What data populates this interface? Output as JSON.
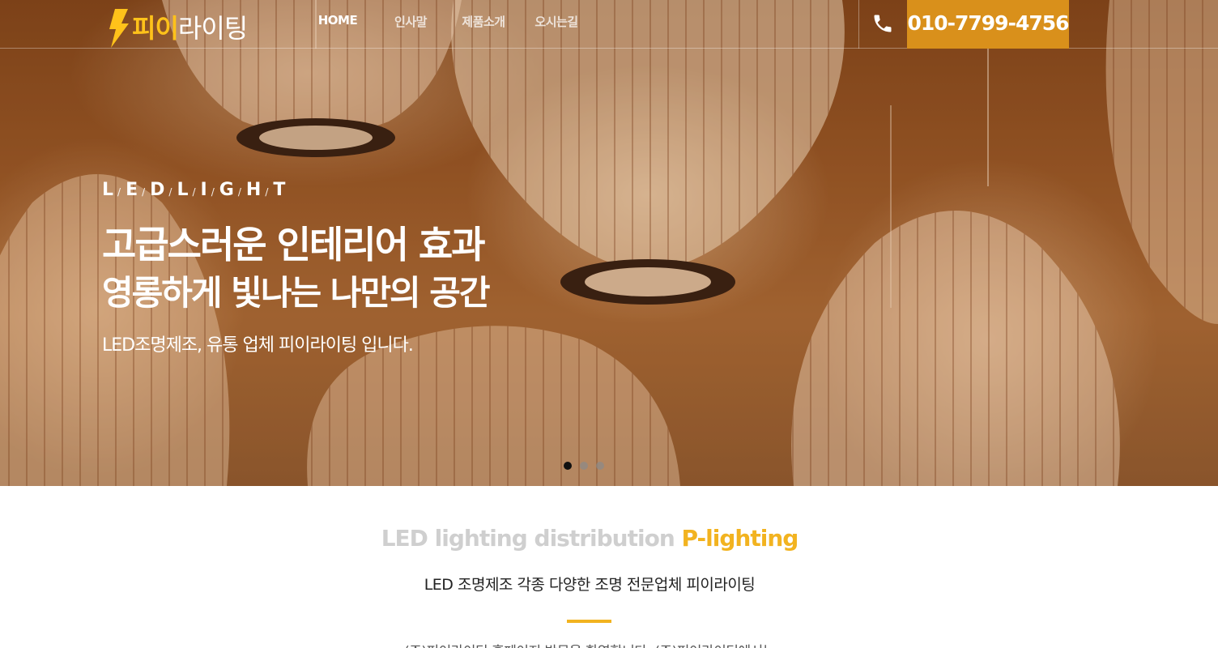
{
  "brand": {
    "name_highlight": "피이",
    "name_rest": "라이팅",
    "accent_color": "#ffc21a"
  },
  "nav": {
    "items": [
      {
        "label": "HOME",
        "active": true
      },
      {
        "label": "인사말",
        "active": false
      },
      {
        "label": "제품소개",
        "active": false
      },
      {
        "label": "오시는길",
        "active": false
      }
    ]
  },
  "contact": {
    "icon": "phone-icon",
    "phone": "010-7799-4756",
    "box_color": "#d9901b"
  },
  "hero": {
    "eyebrow_letters": [
      "L",
      "E",
      "D",
      "L",
      "I",
      "G",
      "H",
      "T"
    ],
    "title": "고급스러운 인테리어 효과",
    "subtitle": "영롱하게 빛나는 나만의 공간",
    "description": "LED조명제조, 유통 업체 피이라이팅 입니다.",
    "slides_total": 3,
    "slide_active": 1
  },
  "intro": {
    "title_gray": "LED lighting distribution",
    "title_orange": "P-lighting",
    "subtitle": "LED 조명제조 각종 다양한 조명 전문업체 피이라이팅",
    "body": "(주)피이라이팅 홈페이지 방문을 환영합니다. (주)피이라이팅에서는",
    "accent_color": "#f2b320"
  }
}
